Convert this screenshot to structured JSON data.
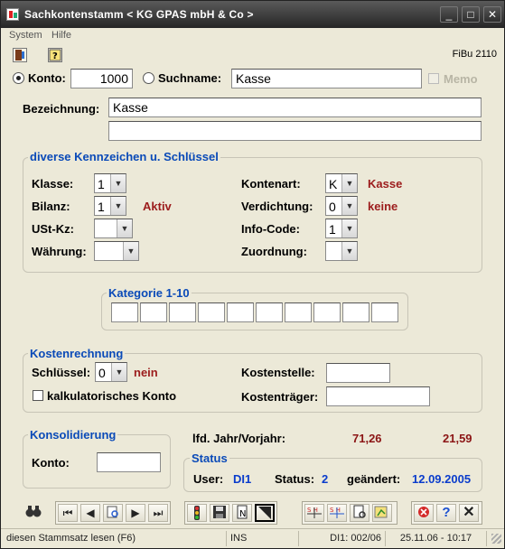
{
  "titlebar": {
    "title": "Sachkontenstamm < KG GPAS mbH & Co  >",
    "minimize": "_",
    "maximize": "□",
    "close": "✕"
  },
  "menu": {
    "items": [
      "System",
      "Hilfe"
    ]
  },
  "program_id": "FiBu 2110",
  "search": {
    "konto_label": "Konto:",
    "konto_value": "1000",
    "suchname_label": "Suchname:",
    "suchname_value": "Kasse",
    "memo_label": "Memo"
  },
  "bezeichnung": {
    "label": "Bezeichnung:",
    "line1": "Kasse",
    "line2": ""
  },
  "kennzeichen": {
    "title": "diverse Kennzeichen u. Schlüssel",
    "klasse_label": "Klasse:",
    "klasse_value": "1",
    "bilanz_label": "Bilanz:",
    "bilanz_value": "1",
    "bilanz_text": "Aktiv",
    "ustkz_label": "USt-Kz:",
    "ustkz_value": "",
    "waehrung_label": "Währung:",
    "waehrung_value": "",
    "kontenart_label": "Kontenart:",
    "kontenart_value": "K",
    "kontenart_text": "Kasse",
    "verdichtung_label": "Verdichtung:",
    "verdichtung_value": "0",
    "verdichtung_text": "keine",
    "infocode_label": "Info-Code:",
    "infocode_value": "1",
    "zuordnung_label": "Zuordnung:",
    "zuordnung_value": ""
  },
  "kategorie": {
    "title": "Kategorie 1-10",
    "values": [
      "",
      "",
      "",
      "",
      "",
      "",
      "",
      "",
      "",
      ""
    ]
  },
  "kostenrechnung": {
    "title": "Kostenrechnung",
    "schluessel_label": "Schlüssel:",
    "schluessel_value": "0",
    "schluessel_text": "nein",
    "kalk_label": "kalkulatorisches Konto",
    "kostenstelle_label": "Kostenstelle:",
    "kostenstelle_value": "",
    "kostentraeger_label": "Kostenträger:",
    "kostentraeger_value": ""
  },
  "konsolidierung": {
    "title": "Konsolidierung",
    "konto_label": "Konto:",
    "konto_value": ""
  },
  "jahr": {
    "label": "lfd. Jahr/Vorjahr:",
    "current": "71,26",
    "previous": "21,59"
  },
  "status": {
    "title": "Status",
    "user_label": "User:",
    "user_value": "DI1",
    "status_label": "Status:",
    "status_value": "2",
    "changed_label": "geändert:",
    "changed_value": "12.09.2005"
  },
  "statusbar": {
    "message": "diesen Stammsatz lesen (F6)",
    "mode": "INS",
    "record": "DI1: 002/06",
    "datetime": "25.11.06 - 10:17"
  },
  "colors": {
    "accent_blue": "#0a4ab8",
    "value_red": "#9c1c1c",
    "status_blue": "#0a3ccc"
  }
}
